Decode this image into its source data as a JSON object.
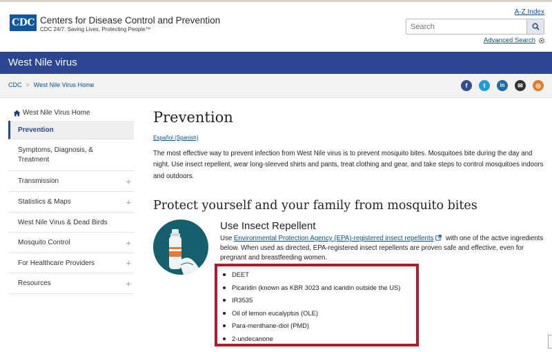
{
  "header": {
    "logo": "CDC",
    "org_name": "Centers for Disease Control and Prevention",
    "tagline": "CDC 24/7: Saving Lives, Protecting People™",
    "az_index": "A-Z Index",
    "search_placeholder": "Search",
    "advanced_search": "Advanced Search"
  },
  "titlebar": {
    "title": "West Nile virus"
  },
  "breadcrumb": {
    "items": [
      "CDC",
      "West Nile Virus Home"
    ]
  },
  "social": [
    "facebook-icon",
    "twitter-icon",
    "linkedin-icon",
    "email-icon",
    "syndicate-icon"
  ],
  "sidebar": {
    "home": "West Nile Virus Home",
    "items": [
      {
        "label": "Prevention",
        "active": true,
        "expandable": false
      },
      {
        "label": "Symptoms, Diagnosis, & Treatment",
        "active": false,
        "expandable": false
      },
      {
        "label": "Transmission",
        "active": false,
        "expandable": true
      },
      {
        "label": "Statistics & Maps",
        "active": false,
        "expandable": true
      },
      {
        "label": "West Nile Virus & Dead Birds",
        "active": false,
        "expandable": false
      },
      {
        "label": "Mosquito Control",
        "active": false,
        "expandable": true
      },
      {
        "label": "For Healthcare Providers",
        "active": false,
        "expandable": true
      },
      {
        "label": "Resources",
        "active": false,
        "expandable": true
      }
    ]
  },
  "main": {
    "title": "Prevention",
    "spanish_link": "Español (Spanish)",
    "intro": "The most effective way to prevent infection from West Nile virus is to prevent mosquito bites. Mosquitoes bite during the day and night. Use insect repellent, wear long-sleeved shirts and pants, treat clothing and gear, and take steps to control mosquitoes indoors and outdoors.",
    "section_heading": "Protect yourself and your family from mosquito bites",
    "repellent": {
      "heading": "Use Insect Repellent",
      "text_prefix": "Use ",
      "link": "Environmental Protection Agency (EPA)-registered insect repellents",
      "text_suffix": " with one of the active ingredients below. When used as directed, EPA-registered insect repellents are proven safe and effective, even for pregnant and breastfeeding women.",
      "ingredients": [
        "DEET",
        "Picaridin (known as KBR 3023 and icaridin outside the US)",
        "IR3535",
        "Oil of lemon eucalyptus (OLE)",
        "Para-menthane-diol (PMD)",
        "2-undecanone"
      ]
    }
  },
  "colors": {
    "brand_blue": "#2b4593",
    "link": "#075290",
    "highlight_red": "#b11c29"
  }
}
